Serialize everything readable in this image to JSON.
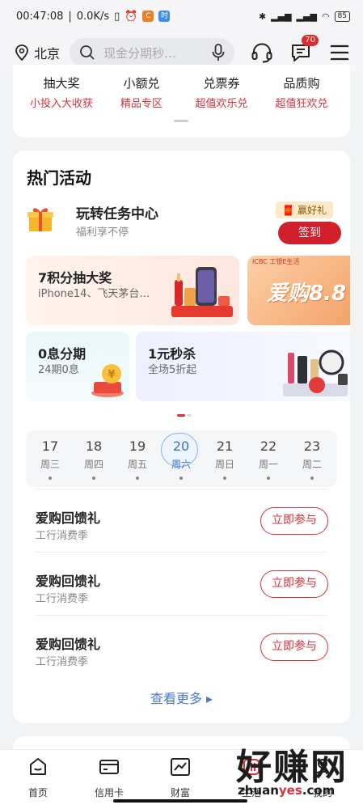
{
  "status_bar": {
    "time": "00:47:08",
    "speed": "0.0K/s",
    "battery": "85"
  },
  "header": {
    "location": "北京",
    "search_placeholder": "现金分期秒…",
    "message_badge": "70"
  },
  "quick_links": [
    {
      "title": "抽大奖",
      "subtitle": "小投入大收获"
    },
    {
      "title": "小额兑",
      "subtitle": "精品专区"
    },
    {
      "title": "兑票券",
      "subtitle": "超值欢乐兑"
    },
    {
      "title": "品质购",
      "subtitle": "超值狂欢兑"
    }
  ],
  "hot": {
    "title": "热门活动",
    "task_title": "玩转任务中心",
    "task_subtitle": "福利享不停",
    "win_tag": "赢好礼",
    "signin": "签到",
    "promos": [
      {
        "title": "7积分抽大奖",
        "subtitle": "iPhone14、飞天茅台…"
      },
      {
        "title": "爱购8.8",
        "subtitle": "ICBC 工银E生活"
      },
      {
        "title": "0息分期",
        "subtitle": "24期0息"
      },
      {
        "title": "1元秒杀",
        "subtitle": "全场5折起"
      }
    ],
    "days": [
      {
        "num": "17",
        "week": "周三"
      },
      {
        "num": "18",
        "week": "周四"
      },
      {
        "num": "19",
        "week": "周五"
      },
      {
        "num": "20",
        "week": "周六"
      },
      {
        "num": "21",
        "week": "周日"
      },
      {
        "num": "22",
        "week": "周一"
      },
      {
        "num": "23",
        "week": "周二"
      }
    ],
    "activities": [
      {
        "title": "爱购回馈礼",
        "subtitle": "工行消费季",
        "button": "立即参与"
      },
      {
        "title": "爱购回馈礼",
        "subtitle": "工行消费季",
        "button": "立即参与"
      },
      {
        "title": "爱购回馈礼",
        "subtitle": "工行消费季",
        "button": "立即参与"
      }
    ],
    "more": "查看更多 ▸"
  },
  "tabs": [
    {
      "label": "首页",
      "icon": "home-icon"
    },
    {
      "label": "信用卡",
      "icon": "card-icon"
    },
    {
      "label": "财富",
      "icon": "chart-icon"
    },
    {
      "label": "生活",
      "icon": "life-icon"
    },
    {
      "label": "我的",
      "icon": "user-icon"
    }
  ],
  "watermark": {
    "big": "好赚网",
    "small_a": "zhuan",
    "small_b": "yes",
    "small_c": ".com"
  },
  "colors": {
    "brand_red": "#d21f2c",
    "link_blue": "#4a79c8"
  }
}
